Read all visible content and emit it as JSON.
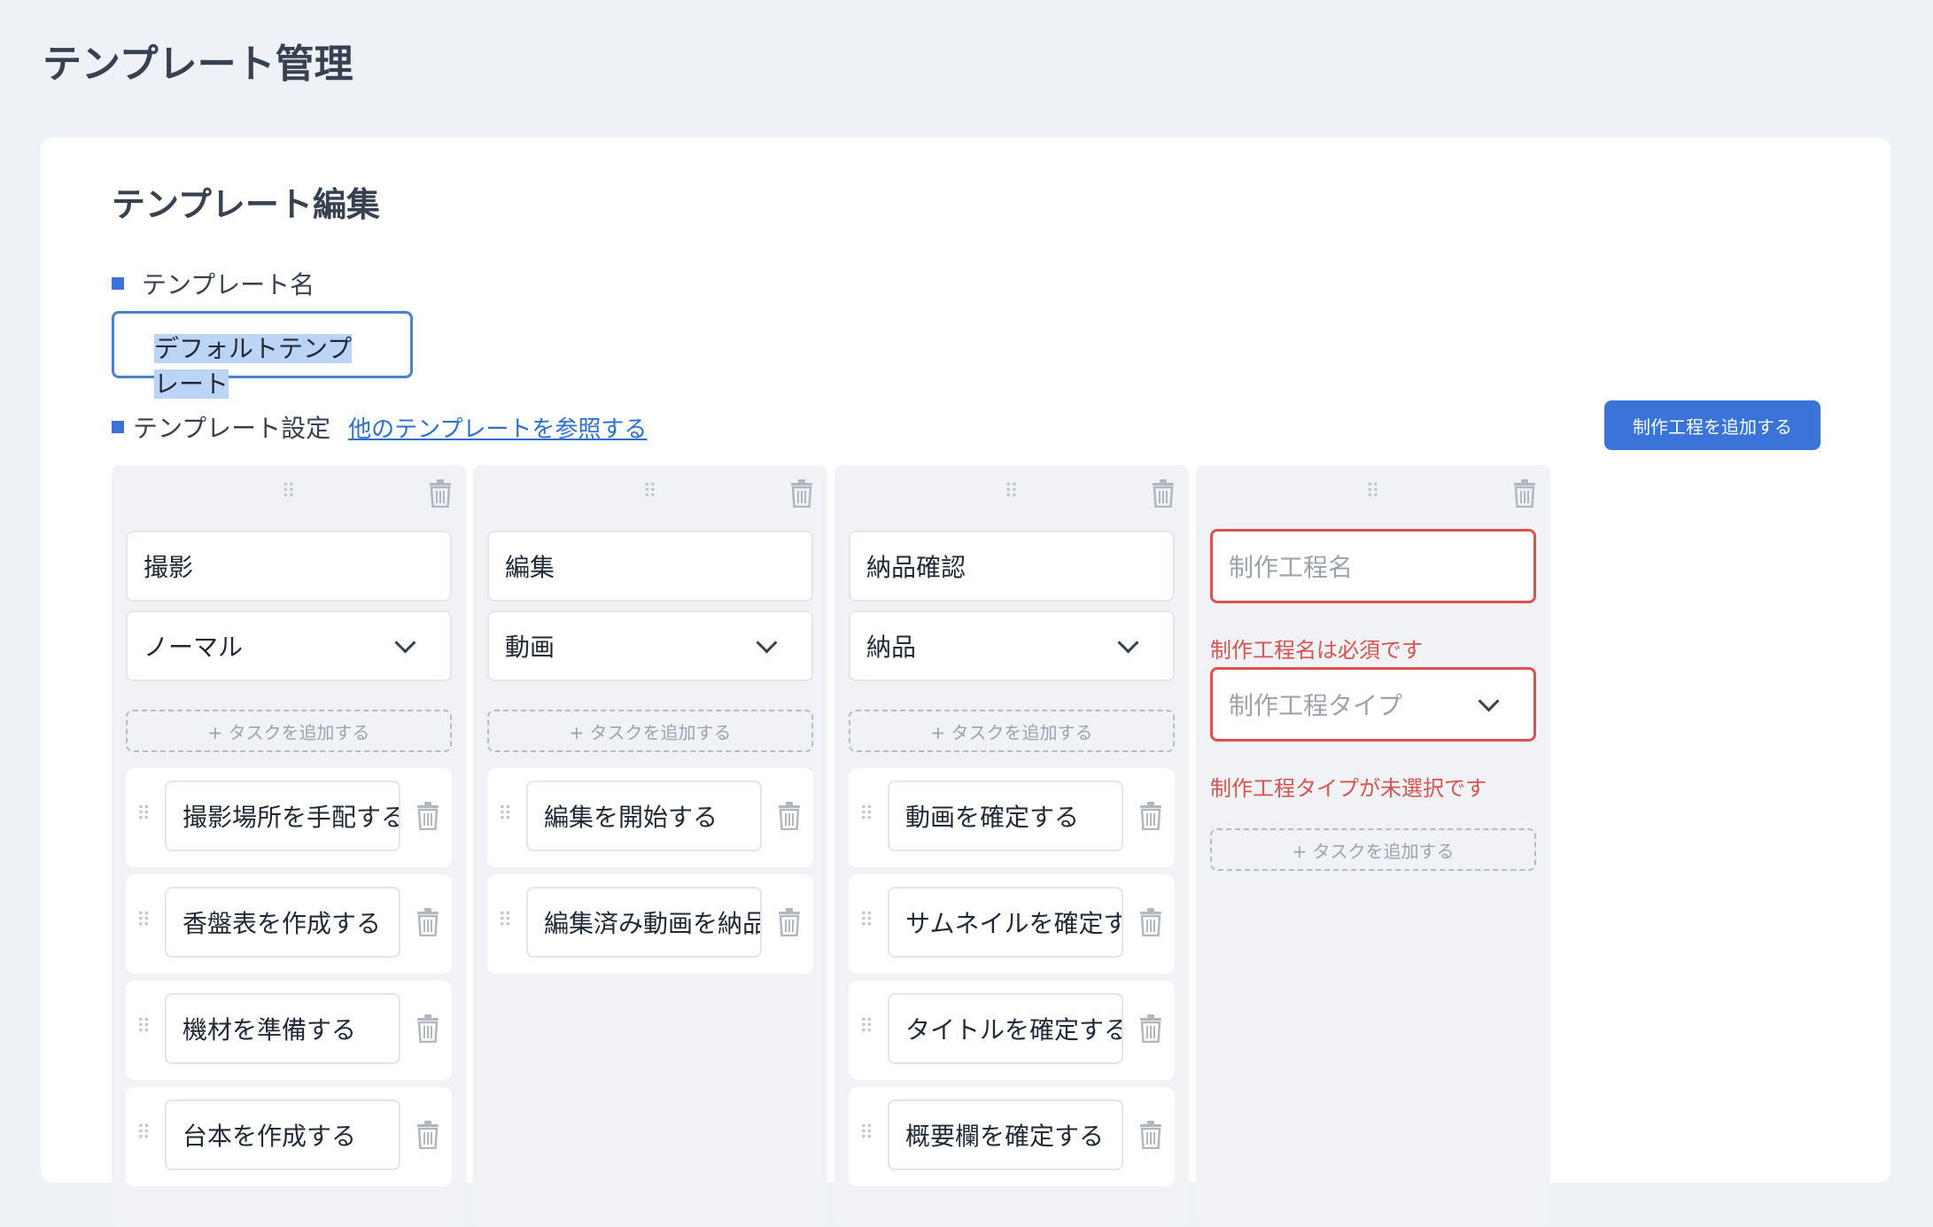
{
  "page": {
    "title": "テンプレート管理"
  },
  "editor": {
    "title": "テンプレート編集",
    "name_label": "テンプレート名",
    "name_value": "デフォルトテンプレート",
    "settings_label": "テンプレート設定",
    "reference_link": "他のテンプレートを参照する",
    "add_process_button": "制作工程を追加する"
  },
  "add_task_label": "+ タスクを追加する",
  "columns": [
    {
      "name": "撮影",
      "type": "ノーマル",
      "tasks": [
        "撮影場所を手配する",
        "香盤表を作成する",
        "機材を準備する",
        "台本を作成する"
      ]
    },
    {
      "name": "編集",
      "type": "動画",
      "tasks": [
        "編集を開始する",
        "編集済み動画を納品する"
      ]
    },
    {
      "name": "納品確認",
      "type": "納品",
      "tasks": [
        "動画を確定する",
        "サムネイルを確定する",
        "タイトルを確定する",
        "概要欄を確定する"
      ]
    },
    {
      "name_placeholder": "制作工程名",
      "name_error": "制作工程名は必須です",
      "type_placeholder": "制作工程タイプ",
      "type_error": "制作工程タイプが未選択です"
    }
  ],
  "icons": {
    "drag": "drag-handle-icon",
    "trash": "trash-icon",
    "chevron": "chevron-down-icon"
  },
  "colors": {
    "accent": "#3a74d8",
    "error": "#d9534f",
    "link": "#2d6fd2"
  }
}
